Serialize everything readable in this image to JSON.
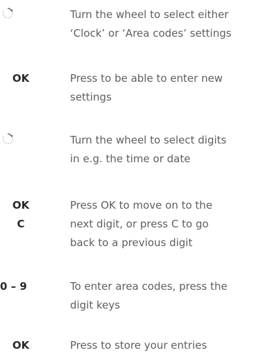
{
  "steps": [
    {
      "key_lines": [],
      "icon": "wheel-icon",
      "description": "Turn the wheel to select either\n‘Clock’ or ‘Area codes’ settings"
    },
    {
      "key_lines": [
        "OK"
      ],
      "description": "Press to be able to enter new\nsettings"
    },
    {
      "key_lines": [],
      "icon": "wheel-icon",
      "description": "Turn the wheel to select digits\nin e.g. the time or date"
    },
    {
      "key_lines": [
        "OK",
        "C"
      ],
      "description": "Press OK to move on to the\nnext digit, or press C to go\nback to a previous digit"
    },
    {
      "key_lines": [
        "0 – 9"
      ],
      "description": "To enter area codes, press the\ndigit keys"
    },
    {
      "key_lines": [
        "OK"
      ],
      "description": "Press to store your entries"
    }
  ]
}
